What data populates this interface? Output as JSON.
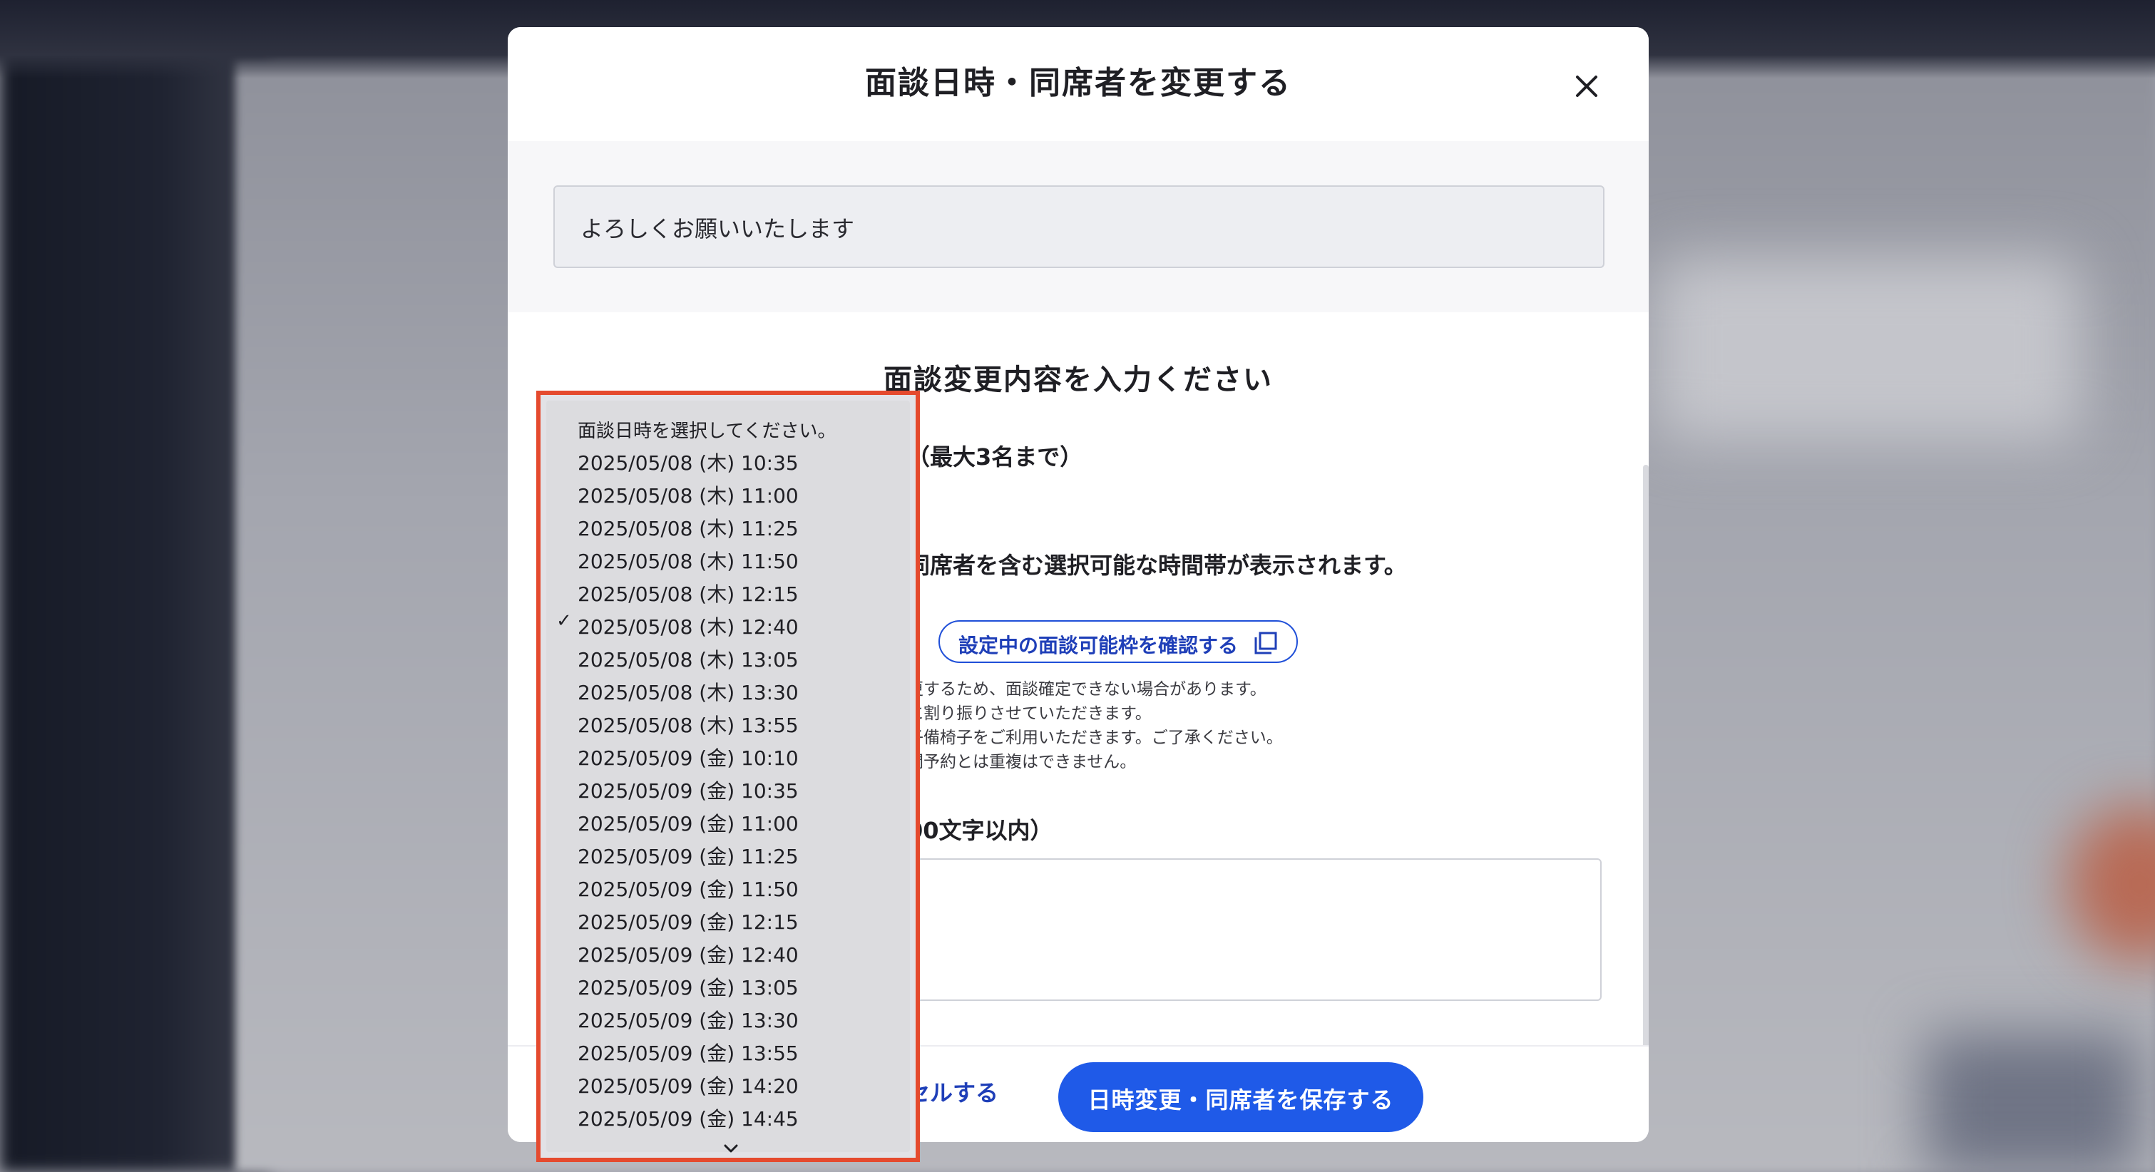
{
  "modal": {
    "title": "面談日時・同席者を変更する",
    "memo_text": "よろしくお願いいたします"
  },
  "form": {
    "section_title": "面談変更内容を入力ください",
    "attendee_label_visible": "（最大3名まで）",
    "selectable_note_visible": "同席者を含む選択可能な時間帯が表示されます。",
    "confirm_link_label": "設定中の面談可能枠を確認する",
    "notes_visible": [
      "更するため、面談確定できない場合があります。",
      "に割り振りさせていただきます。",
      "子備椅子をご利用いただきます。ご了承ください。",
      "間予約とは重複はできません。"
    ],
    "memo_label_visible": "00文字以内）"
  },
  "footer": {
    "cancel_label_visible": "セルする",
    "save_label": "日時変更・同席者を保存する"
  },
  "dropdown": {
    "placeholder": "面談日時を選択してください。",
    "selected_index": 5,
    "check_mark": "✓",
    "options": [
      "2025/05/08 (木) 10:35",
      "2025/05/08 (木) 11:00",
      "2025/05/08 (木) 11:25",
      "2025/05/08 (木) 11:50",
      "2025/05/08 (木) 12:15",
      "2025/05/08 (木) 12:40",
      "2025/05/08 (木) 13:05",
      "2025/05/08 (木) 13:30",
      "2025/05/08 (木) 13:55",
      "2025/05/09 (金) 10:10",
      "2025/05/09 (金) 10:35",
      "2025/05/09 (金) 11:00",
      "2025/05/09 (金) 11:25",
      "2025/05/09 (金) 11:50",
      "2025/05/09 (金) 12:15",
      "2025/05/09 (金) 12:40",
      "2025/05/09 (金) 13:05",
      "2025/05/09 (金) 13:30",
      "2025/05/09 (金) 13:55",
      "2025/05/09 (金) 14:20",
      "2025/05/09 (金) 14:45"
    ]
  },
  "colors": {
    "accent": "#1f5ae8",
    "highlight_border": "#e54a2e"
  }
}
